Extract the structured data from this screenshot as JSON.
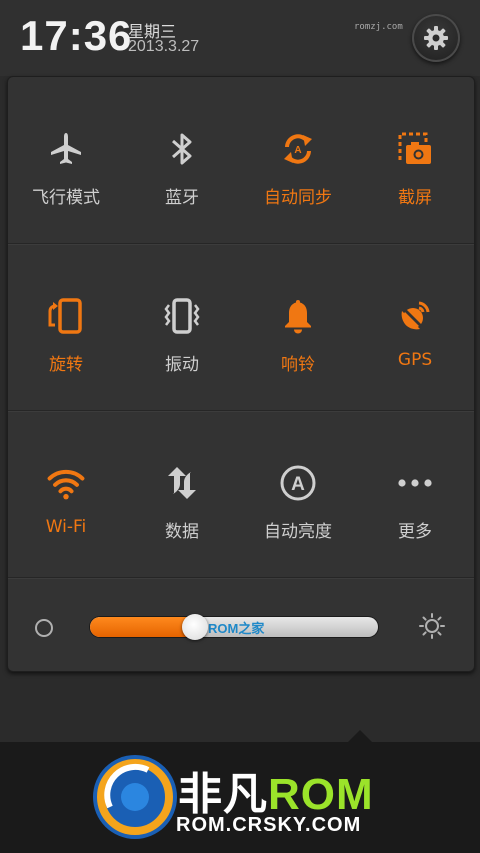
{
  "status": {
    "time": "17:36",
    "weekday": "星期三",
    "date": "2013.3.27",
    "watermark": "romzj.com"
  },
  "toggles": [
    {
      "label": "飞行模式",
      "icon": "airplane-icon",
      "active": false
    },
    {
      "label": "蓝牙",
      "icon": "bluetooth-icon",
      "active": false
    },
    {
      "label": "自动同步",
      "icon": "sync-icon",
      "active": true
    },
    {
      "label": "截屏",
      "icon": "screenshot-icon",
      "active": true
    },
    {
      "label": "旋转",
      "icon": "rotate-icon",
      "active": true
    },
    {
      "label": "振动",
      "icon": "vibrate-icon",
      "active": false
    },
    {
      "label": "响铃",
      "icon": "bell-icon",
      "active": true
    },
    {
      "label": "GPS",
      "icon": "gps-icon",
      "active": true
    },
    {
      "label": "Wi-Fi",
      "icon": "wifi-icon",
      "active": true
    },
    {
      "label": "数据",
      "icon": "data-icon",
      "active": false
    },
    {
      "label": "自动亮度",
      "icon": "auto-brightness-icon",
      "active": false
    },
    {
      "label": "更多",
      "icon": "more-icon",
      "active": false
    }
  ],
  "brightness": {
    "level": 0.35,
    "watermark": "ROM之家"
  },
  "footer": {
    "brand_cn": "非凡",
    "brand_rom": "ROM",
    "url": "ROM.CRSKY.COM"
  },
  "colors": {
    "accent": "#f07712",
    "inactive": "#cfcfcf",
    "panel": "#333333"
  }
}
